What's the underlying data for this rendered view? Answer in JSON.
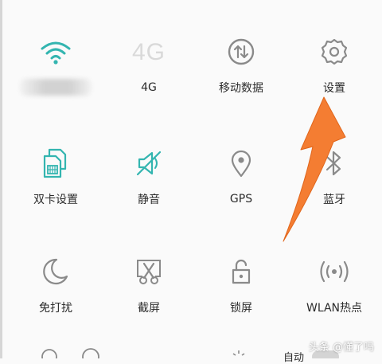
{
  "tiles": [
    {
      "id": "wifi",
      "label": "",
      "icon": "wifi-icon"
    },
    {
      "id": "4g",
      "label": "4G",
      "icon": "4g-icon",
      "icon_text": "4G"
    },
    {
      "id": "mobile-data",
      "label": "移动数据",
      "icon": "mobile-data-icon"
    },
    {
      "id": "settings",
      "label": "设置",
      "icon": "gear-icon"
    },
    {
      "id": "dual-sim",
      "label": "双卡设置",
      "icon": "sim-card-icon"
    },
    {
      "id": "mute",
      "label": "静音",
      "icon": "speaker-mute-icon"
    },
    {
      "id": "gps",
      "label": "GPS",
      "icon": "location-pin-icon"
    },
    {
      "id": "bluetooth",
      "label": "蓝牙",
      "icon": "bluetooth-icon"
    },
    {
      "id": "dnd",
      "label": "免打扰",
      "icon": "moon-icon"
    },
    {
      "id": "screenshot",
      "label": "截屏",
      "icon": "scissors-icon"
    },
    {
      "id": "lock-screen",
      "label": "锁屏",
      "icon": "unlock-icon"
    },
    {
      "id": "wlan-hotspot",
      "label": "WLAN热点",
      "icon": "hotspot-icon"
    }
  ],
  "bottom": {
    "auto_label": "自动"
  },
  "watermark": "头条 @懂了吗",
  "colors": {
    "accent": "#33b5b0",
    "icon_gray": "#8a8a8a",
    "arrow": "#f47d32"
  }
}
